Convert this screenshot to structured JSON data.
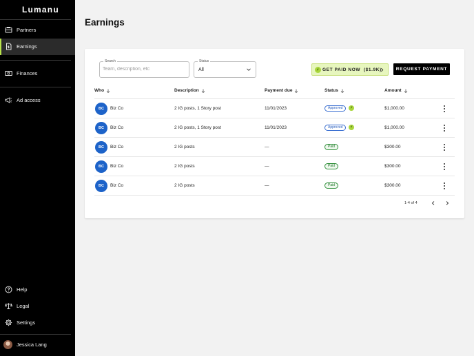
{
  "app": {
    "logo": "Lumanu"
  },
  "sidebar": {
    "items": [
      {
        "label": "Partners",
        "icon": "partners-icon",
        "active": false
      },
      {
        "label": "Earnings",
        "icon": "earnings-icon",
        "active": true
      },
      {
        "label": "Finances",
        "icon": "finances-icon",
        "active": false
      },
      {
        "label": "Ad access",
        "icon": "ad-access-icon",
        "active": false
      }
    ],
    "bottom_items": [
      {
        "label": "Help",
        "icon": "help-icon"
      },
      {
        "label": "Legal",
        "icon": "legal-icon"
      },
      {
        "label": "Settings",
        "icon": "settings-icon"
      }
    ],
    "user": {
      "name": "Jessica Lang"
    }
  },
  "page": {
    "title": "Earnings"
  },
  "filters": {
    "search_label": "Search",
    "search_placeholder": "Team, description, etc",
    "search_value": "",
    "status_label": "Status",
    "status_value": "All"
  },
  "actions": {
    "get_paid_label": "GET PAID NOW  ($1.9K)",
    "request_payment_label": "REQUEST PAYMENT"
  },
  "table": {
    "columns": [
      "Who",
      "Description",
      "Payment due",
      "Status",
      "Amount"
    ],
    "rows": [
      {
        "initials": "BC",
        "who": "Biz Co",
        "description": "2 IG posts, 1 Story post",
        "payment_due": "11/01/2023",
        "status": "Approved",
        "instant": true,
        "amount": "$1,000.00"
      },
      {
        "initials": "BC",
        "who": "Biz Co",
        "description": "2 IG posts, 1 Story post",
        "payment_due": "11/01/2023",
        "status": "Approved",
        "instant": true,
        "amount": "$1,000.00"
      },
      {
        "initials": "BC",
        "who": "Biz Co",
        "description": "2 IG posts",
        "payment_due": "—",
        "status": "Paid",
        "instant": false,
        "amount": "$300.00"
      },
      {
        "initials": "BC",
        "who": "Biz Co",
        "description": "2 IG posts",
        "payment_due": "—",
        "status": "Paid",
        "instant": false,
        "amount": "$300.00"
      },
      {
        "initials": "BC",
        "who": "Biz Co",
        "description": "2 IG posts",
        "payment_due": "—",
        "status": "Paid",
        "instant": false,
        "amount": "$300.00"
      }
    ]
  },
  "pagination": {
    "text": "1-4 of 4"
  },
  "colors": {
    "sidebar_bg": "#000000",
    "accent": "#b8e24a",
    "avatar_blue": "#1d63c9",
    "approved_blue": "#2a5fbf",
    "paid_green": "#21792c"
  }
}
